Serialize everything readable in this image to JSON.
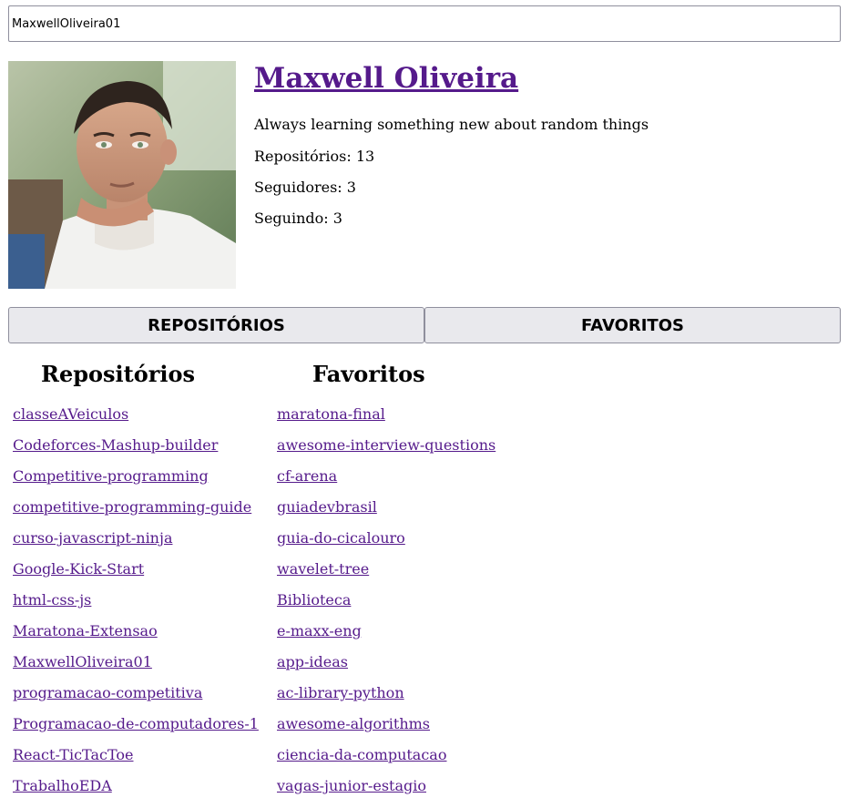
{
  "search": {
    "value": "MaxwellOliveira01"
  },
  "profile": {
    "name": "Maxwell Oliveira",
    "bio": "Always learning something new about random things",
    "repositories": "Repositórios: 13",
    "followers": "Seguidores: 3",
    "following": "Seguindo: 3"
  },
  "tabs": [
    {
      "label": "REPOSITÓRIOS"
    },
    {
      "label": "FAVORITOS"
    }
  ],
  "columns": {
    "repos_title": "Repositórios",
    "favs_title": "Favoritos"
  },
  "repositories": [
    "classeAVeiculos",
    "Codeforces-Mashup-builder",
    "Competitive-programming",
    "competitive-programming-guide",
    "curso-javascript-ninja",
    "Google-Kick-Start",
    "html-css-js",
    "Maratona-Extensao",
    "MaxwellOliveira01",
    "programacao-competitiva",
    "Programacao-de-computadores-1",
    "React-TicTacToe",
    "TrabalhoEDA"
  ],
  "favorites": [
    "maratona-final",
    "awesome-interview-questions",
    "cf-arena",
    "guiadevbrasil",
    "guia-do-cicalouro",
    "wavelet-tree",
    "Biblioteca",
    "e-maxx-eng",
    "app-ideas",
    "ac-library-python",
    "awesome-algorithms",
    "ciencia-da-computacao",
    "vagas-junior-estagio"
  ],
  "colors": {
    "link": "#551a8b",
    "button_bg": "#e9e9ed",
    "border": "#8f8f9d"
  }
}
